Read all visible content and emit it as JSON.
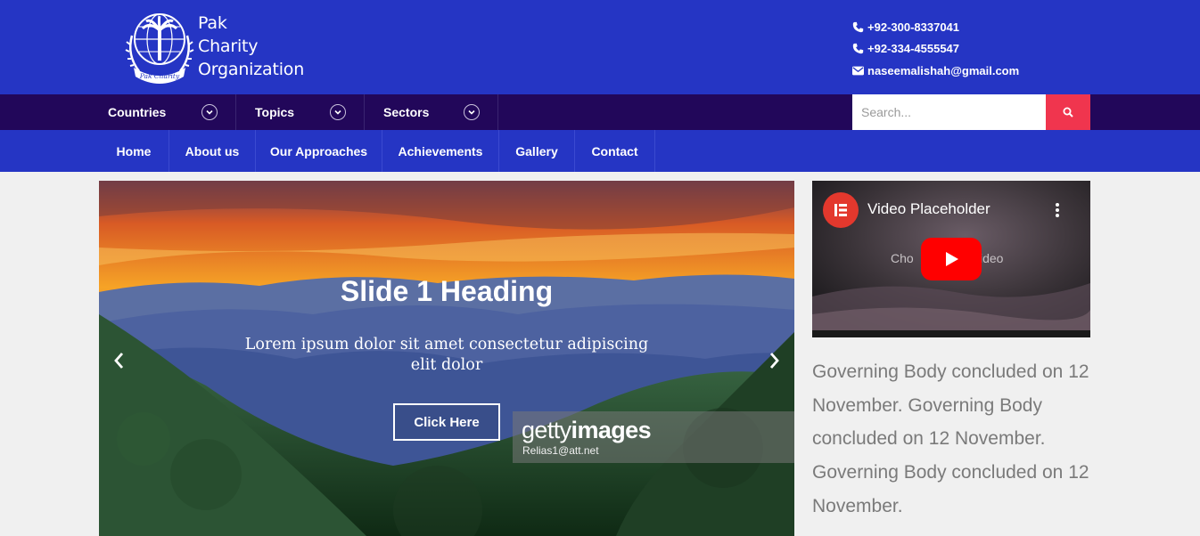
{
  "brand": {
    "name_line1": "Pak",
    "name_line2": "Charity",
    "name_line3": "Organization",
    "seal_text": "Pak Charity"
  },
  "contact": {
    "phone1": "+92-300-8337041",
    "phone2": "+92-334-4555547",
    "email": "naseemalishah@gmail.com"
  },
  "dropdown_menu": [
    {
      "label": "Countries"
    },
    {
      "label": "Topics"
    },
    {
      "label": "Sectors"
    }
  ],
  "search": {
    "placeholder": "Search..."
  },
  "main_nav": [
    {
      "label": "Home"
    },
    {
      "label": "About us"
    },
    {
      "label": "Our Approaches"
    },
    {
      "label": "Achievements"
    },
    {
      "label": "Gallery"
    },
    {
      "label": "Contact"
    }
  ],
  "slider": {
    "heading": "Slide 1 Heading",
    "text": "Lorem ipsum dolor sit amet consectetur adipiscing elit dolor",
    "button_label": "Click Here",
    "watermark_brand_light": "getty",
    "watermark_brand_bold": "images",
    "watermark_credit": "Relias1@att.net"
  },
  "video": {
    "title": "Video Placeholder",
    "faded_left": "Cho",
    "faded_right": "ideo"
  },
  "sidebar_text": "Governing Body concluded on 12 November. Governing Body concluded on 12 November. Governing Body concluded on 12 November.",
  "colors": {
    "header_blue": "#2535c4",
    "dark_bar": "#22075a",
    "search_button": "#f0354e",
    "youtube_red": "#ff0000",
    "elementor_red": "#e3382d"
  }
}
